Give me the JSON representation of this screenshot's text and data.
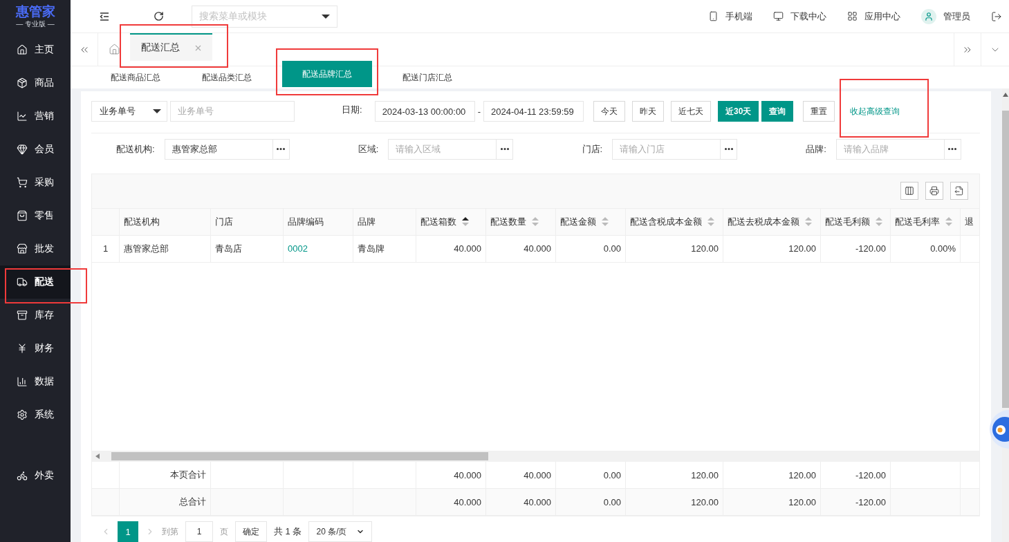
{
  "brand": {
    "name": "惠管家",
    "edition": "— 专业版 —"
  },
  "sidebar": {
    "items": [
      {
        "label": "主页",
        "selected": false,
        "highlighted": false
      },
      {
        "label": "商品",
        "selected": false,
        "highlighted": false
      },
      {
        "label": "营销",
        "selected": false,
        "highlighted": false
      },
      {
        "label": "会员",
        "selected": false,
        "highlighted": false
      },
      {
        "label": "采购",
        "selected": false,
        "highlighted": false
      },
      {
        "label": "零售",
        "selected": false,
        "highlighted": false
      },
      {
        "label": "批发",
        "selected": false,
        "highlighted": false
      },
      {
        "label": "配送",
        "selected": true,
        "highlighted": true
      },
      {
        "label": "库存",
        "selected": false,
        "highlighted": false
      },
      {
        "label": "财务",
        "selected": false,
        "highlighted": false
      },
      {
        "label": "数据",
        "selected": false,
        "highlighted": false
      },
      {
        "label": "系统",
        "selected": false,
        "highlighted": false
      }
    ],
    "extra_items": [
      {
        "label": "外卖",
        "selected": false,
        "highlighted": false
      }
    ]
  },
  "topbar": {
    "search": {
      "placeholder": "搜索菜单或模块"
    },
    "links": [
      "手机端",
      "下载中心",
      "应用中心"
    ],
    "user": "管理员"
  },
  "page_tabs": [
    {
      "label": "配送汇总",
      "selected": true,
      "highlighted": true
    }
  ],
  "sub_tabs": [
    {
      "label": "配送商品汇总",
      "selected": false,
      "highlighted": false
    },
    {
      "label": "配送品类汇总",
      "selected": false,
      "highlighted": false
    },
    {
      "label": "配送品牌汇总",
      "selected": true,
      "highlighted": true
    },
    {
      "label": "配送门店汇总",
      "selected": false,
      "highlighted": false
    }
  ],
  "filters": {
    "search_type": "业务单号",
    "search_placeholder": "业务单号",
    "date_label": "日期:",
    "date_from": "2024-03-13 00:00:00",
    "date_separator": "-",
    "date_to": "2024-04-11 23:59:59",
    "ranges": [
      {
        "label": "今天",
        "selected": false
      },
      {
        "label": "昨天",
        "selected": false
      },
      {
        "label": "近七天",
        "selected": false
      },
      {
        "label": "近30天",
        "selected": true
      }
    ],
    "buttons": [
      {
        "label": "查询",
        "kind": "primary"
      },
      {
        "label": "重置",
        "kind": "default"
      }
    ],
    "toggle": {
      "label": "收起高级查询",
      "highlighted": true
    },
    "fields": [
      {
        "label": "配送机构:",
        "value": "惠管家总部"
      },
      {
        "label": "区域:",
        "placeholder": "请输入区域"
      },
      {
        "label": "门店:",
        "placeholder": "请输入门店"
      },
      {
        "label": "品牌:",
        "placeholder": "请输入品牌"
      }
    ]
  },
  "table": {
    "columns": [
      {
        "label": "配送机构",
        "kind": "text"
      },
      {
        "label": "门店",
        "kind": "text"
      },
      {
        "label": "品牌编码",
        "kind": "link"
      },
      {
        "label": "品牌",
        "kind": "text"
      },
      {
        "label": "配送箱数",
        "kind": "number",
        "sorted": true
      },
      {
        "label": "配送数量",
        "kind": "number",
        "sorted": false
      },
      {
        "label": "配送金额",
        "kind": "number",
        "sorted": false
      },
      {
        "label": "配送含税成本金额",
        "kind": "number",
        "sorted": false
      },
      {
        "label": "配送去税成本金额",
        "kind": "number",
        "sorted": false
      },
      {
        "label": "配送毛利额",
        "kind": "number",
        "sorted": false
      },
      {
        "label": "配送毛利率",
        "kind": "number",
        "sorted": false
      },
      {
        "label": "退"
      }
    ],
    "rows": [
      {
        "index": "1",
        "cells": [
          "惠管家总部",
          "青岛店",
          "0002",
          "青岛牌",
          "40.000",
          "40.000",
          "0.00",
          "120.00",
          "120.00",
          "-120.00",
          "0.00%",
          ""
        ]
      }
    ],
    "summary": [
      {
        "label": "本页合计",
        "cells": [
          "",
          "",
          "",
          "40.000",
          "40.000",
          "0.00",
          "120.00",
          "120.00",
          "-120.00",
          "",
          ""
        ]
      },
      {
        "label": "总合计",
        "cells": [
          "",
          "",
          "",
          "40.000",
          "40.000",
          "0.00",
          "120.00",
          "120.00",
          "-120.00",
          "",
          ""
        ]
      }
    ]
  },
  "pagination": {
    "current": "1",
    "goto_label": "到第",
    "goto_value": "1",
    "page_label": "页",
    "confirm": "确定",
    "total": "共 1 条",
    "page_size": "20 条/页"
  }
}
